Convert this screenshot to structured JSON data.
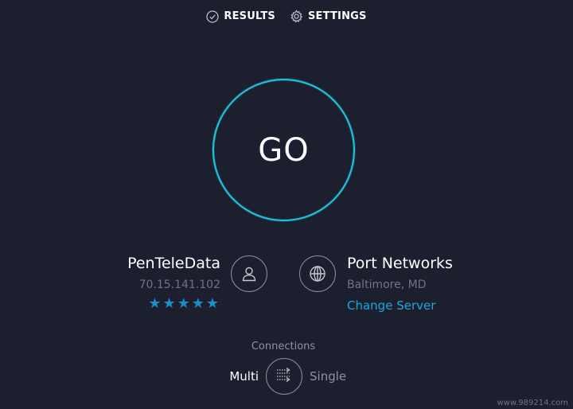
{
  "nav": {
    "results_label": "RESULTS",
    "settings_label": "SETTINGS"
  },
  "go_button": {
    "label": "GO",
    "ring_color": "#22c4e0"
  },
  "isp": {
    "name": "PenTeleData",
    "ip": "70.15.141.102",
    "rating_stars": "★★★★★",
    "rating": 5,
    "star_color": "#1a8fc8"
  },
  "server": {
    "name": "Port Networks",
    "location": "Baltimore, MD",
    "change_label": "Change Server",
    "link_color": "#1aa8e0"
  },
  "connections": {
    "label": "Connections",
    "multi_label": "Multi",
    "single_label": "Single",
    "selected": "Multi"
  },
  "watermark": "www.989214.com",
  "colors": {
    "background": "#1c1f2e",
    "muted_text": "#6f7385"
  }
}
